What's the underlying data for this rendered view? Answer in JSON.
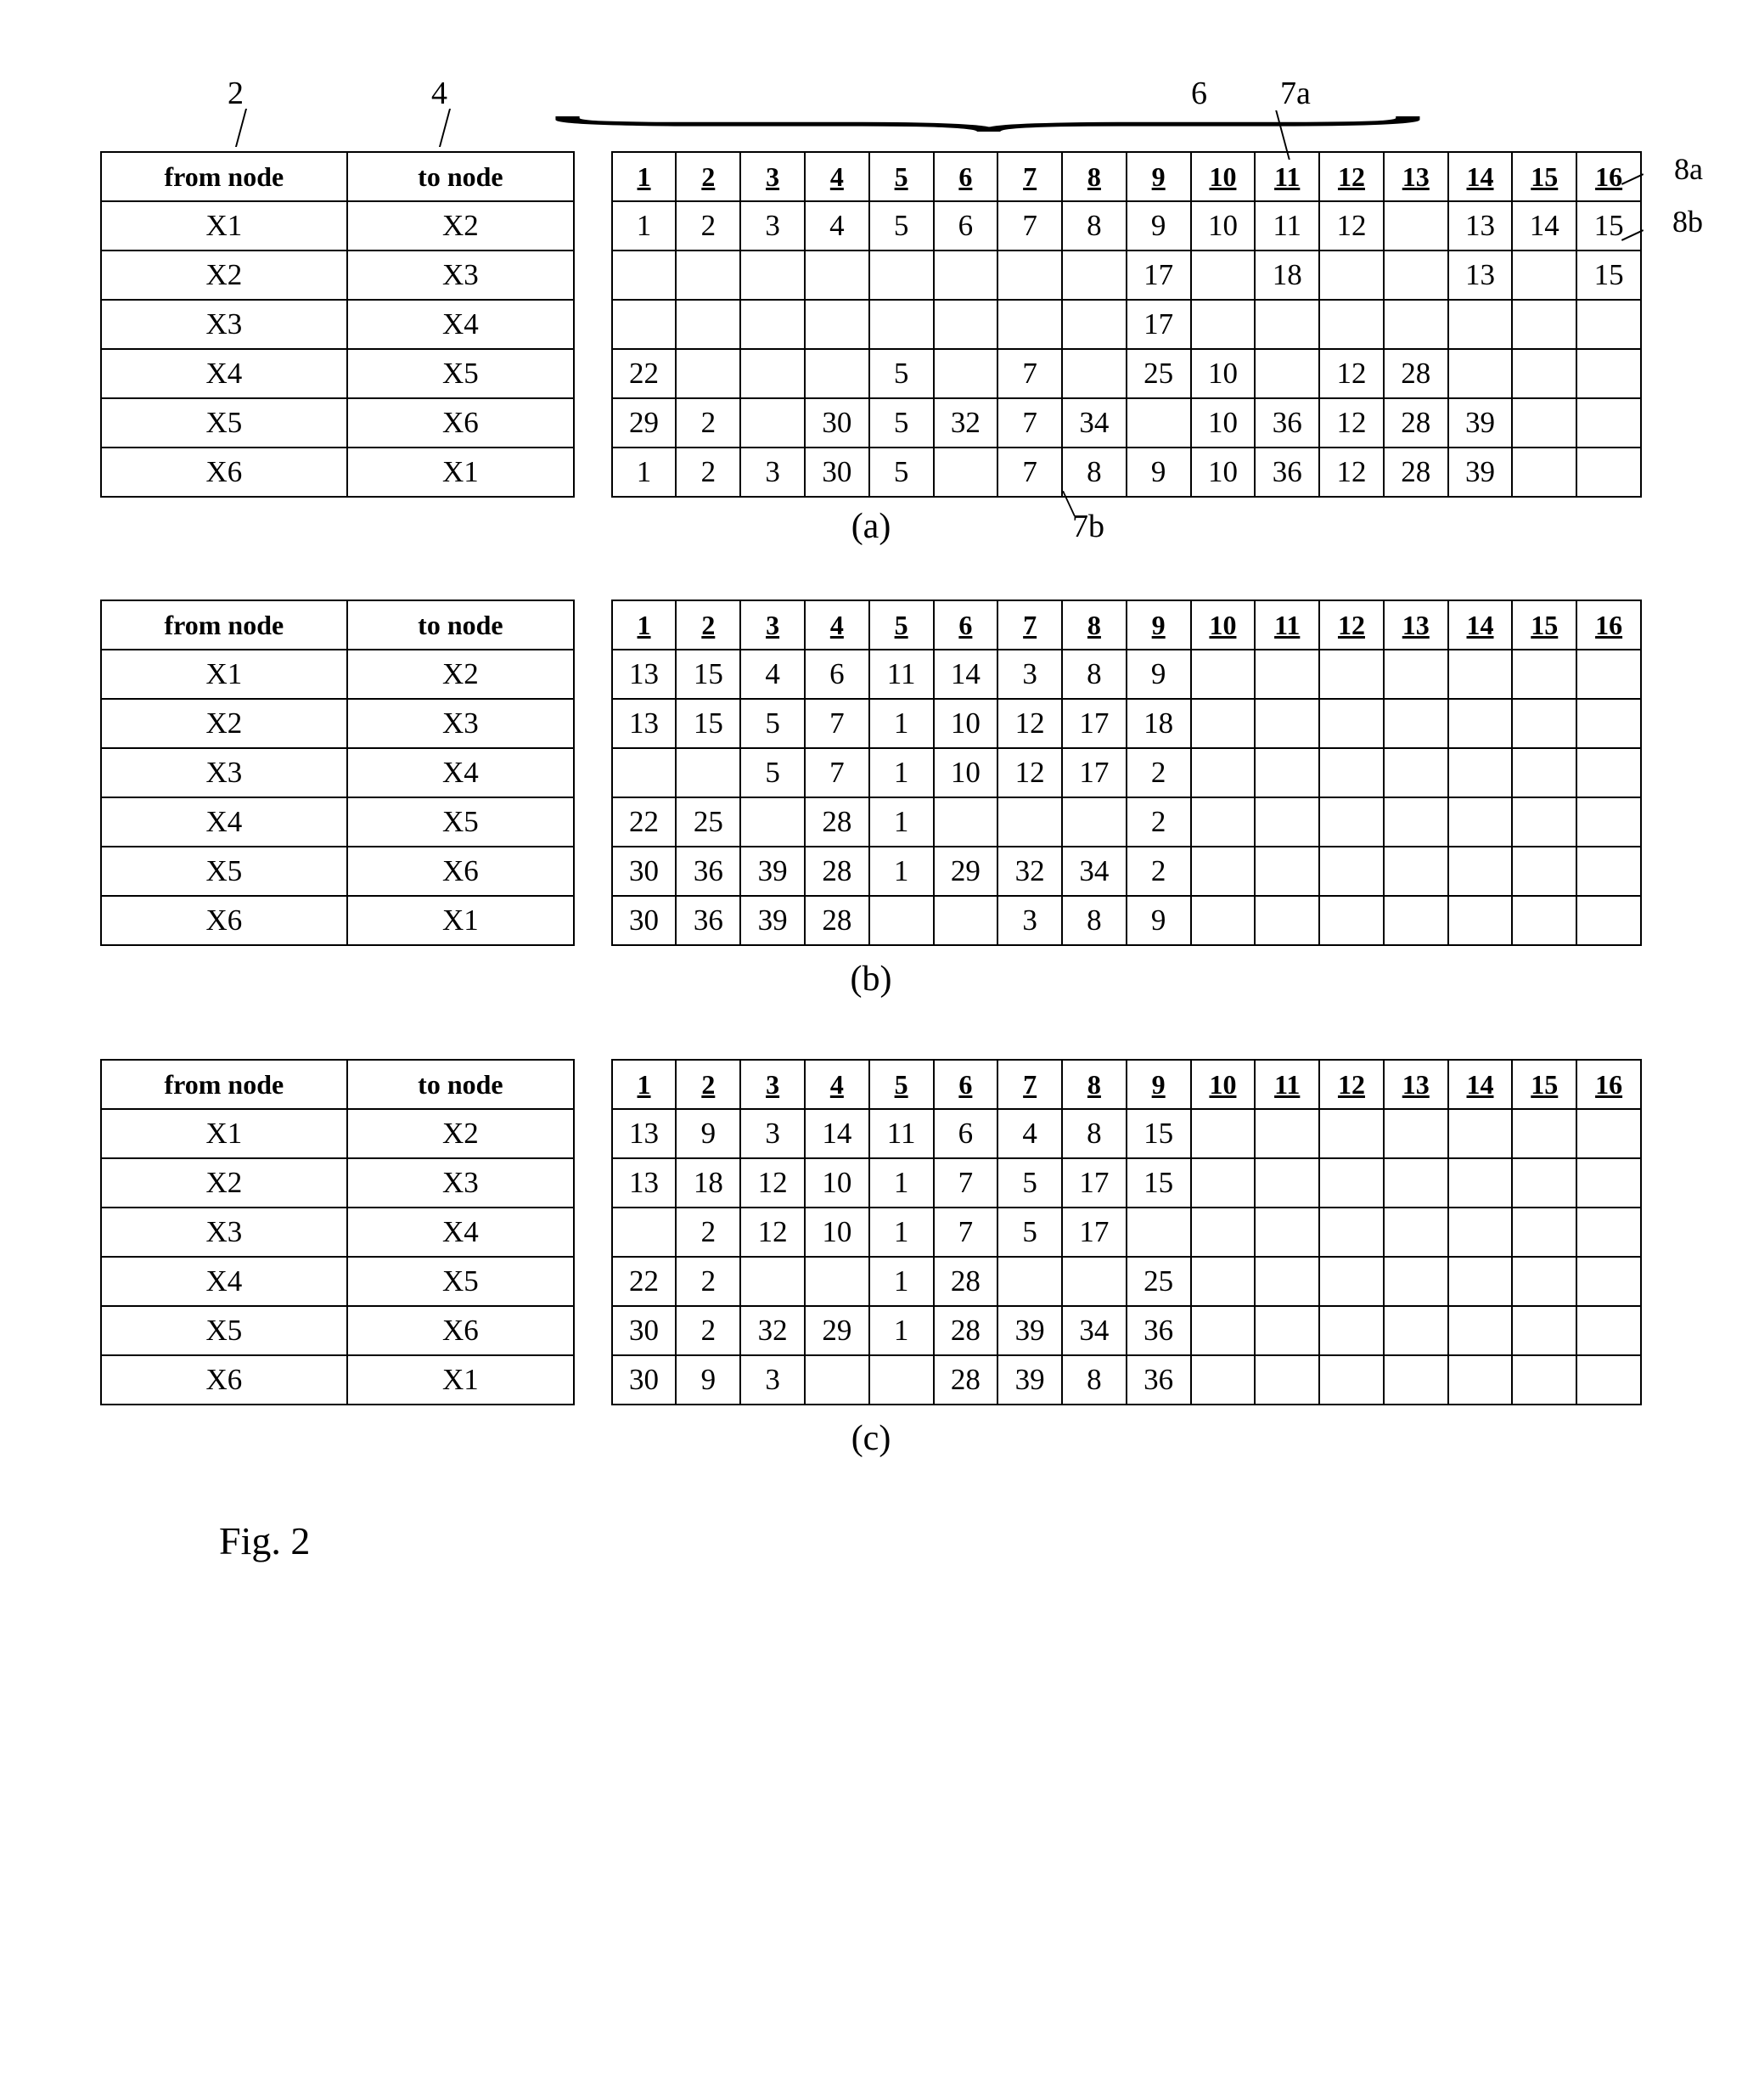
{
  "annotations": {
    "a2": "2",
    "a4": "4",
    "a6": "6",
    "a7a": "7a",
    "a7b": "7b",
    "a8a": "8a",
    "a8b": "8b"
  },
  "headers": {
    "from": "from node",
    "to": "to node",
    "cols": [
      "1",
      "2",
      "3",
      "4",
      "5",
      "6",
      "7",
      "8",
      "9",
      "10",
      "11",
      "12",
      "13",
      "14",
      "15",
      "16"
    ]
  },
  "captions": {
    "a": "(a)",
    "b": "(b)",
    "c": "(c)"
  },
  "figLabel": "Fig. 2",
  "tables": {
    "a": [
      {
        "from": "X1",
        "to": "X2",
        "cells": [
          "1",
          "2",
          "3",
          "4",
          "5",
          "6",
          "7",
          "8",
          "9",
          "10",
          "11",
          "12",
          "",
          "13",
          "14",
          "15"
        ]
      },
      {
        "from": "X2",
        "to": "X3",
        "cells": [
          "",
          "",
          "",
          "",
          "",
          "",
          "",
          "",
          "17",
          "",
          "18",
          "",
          "",
          "13",
          "",
          "15"
        ]
      },
      {
        "from": "X3",
        "to": "X4",
        "cells": [
          "",
          "",
          "",
          "",
          "",
          "",
          "",
          "",
          "17",
          "",
          "",
          "",
          "",
          "",
          "",
          ""
        ]
      },
      {
        "from": "X4",
        "to": "X5",
        "cells": [
          "22",
          "",
          "",
          "",
          "5",
          "",
          "7",
          "",
          "25",
          "10",
          "",
          "12",
          "28",
          "",
          "",
          ""
        ]
      },
      {
        "from": "X5",
        "to": "X6",
        "cells": [
          "29",
          "2",
          "",
          "30",
          "5",
          "32",
          "7",
          "34",
          "",
          "10",
          "36",
          "12",
          "28",
          "39",
          "",
          ""
        ]
      },
      {
        "from": "X6",
        "to": "X1",
        "cells": [
          "1",
          "2",
          "3",
          "30",
          "5",
          "",
          "7",
          "8",
          "9",
          "10",
          "36",
          "12",
          "28",
          "39",
          "",
          ""
        ]
      }
    ],
    "b": [
      {
        "from": "X1",
        "to": "X2",
        "cells": [
          "13",
          "15",
          "4",
          "6",
          "11",
          "14",
          "3",
          "8",
          "9",
          "",
          "",
          "",
          "",
          "",
          "",
          ""
        ]
      },
      {
        "from": "X2",
        "to": "X3",
        "cells": [
          "13",
          "15",
          "5",
          "7",
          "1",
          "10",
          "12",
          "17",
          "18",
          "",
          "",
          "",
          "",
          "",
          "",
          ""
        ]
      },
      {
        "from": "X3",
        "to": "X4",
        "cells": [
          "",
          "",
          "5",
          "7",
          "1",
          "10",
          "12",
          "17",
          "2",
          "",
          "",
          "",
          "",
          "",
          "",
          ""
        ]
      },
      {
        "from": "X4",
        "to": "X5",
        "cells": [
          "22",
          "25",
          "",
          "28",
          "1",
          "",
          "",
          "",
          "2",
          "",
          "",
          "",
          "",
          "",
          "",
          ""
        ]
      },
      {
        "from": "X5",
        "to": "X6",
        "cells": [
          "30",
          "36",
          "39",
          "28",
          "1",
          "29",
          "32",
          "34",
          "2",
          "",
          "",
          "",
          "",
          "",
          "",
          ""
        ]
      },
      {
        "from": "X6",
        "to": "X1",
        "cells": [
          "30",
          "36",
          "39",
          "28",
          "",
          "",
          "3",
          "8",
          "9",
          "",
          "",
          "",
          "",
          "",
          "",
          ""
        ]
      }
    ],
    "c": [
      {
        "from": "X1",
        "to": "X2",
        "cells": [
          "13",
          "9",
          "3",
          "14",
          "11",
          "6",
          "4",
          "8",
          "15",
          "",
          "",
          "",
          "",
          "",
          "",
          ""
        ]
      },
      {
        "from": "X2",
        "to": "X3",
        "cells": [
          "13",
          "18",
          "12",
          "10",
          "1",
          "7",
          "5",
          "17",
          "15",
          "",
          "",
          "",
          "",
          "",
          "",
          ""
        ]
      },
      {
        "from": "X3",
        "to": "X4",
        "cells": [
          "",
          "2",
          "12",
          "10",
          "1",
          "7",
          "5",
          "17",
          "",
          "",
          "",
          "",
          "",
          "",
          "",
          ""
        ]
      },
      {
        "from": "X4",
        "to": "X5",
        "cells": [
          "22",
          "2",
          "",
          "",
          "1",
          "28",
          "",
          "",
          "25",
          "",
          "",
          "",
          "",
          "",
          "",
          ""
        ]
      },
      {
        "from": "X5",
        "to": "X6",
        "cells": [
          "30",
          "2",
          "32",
          "29",
          "1",
          "28",
          "39",
          "34",
          "36",
          "",
          "",
          "",
          "",
          "",
          "",
          ""
        ]
      },
      {
        "from": "X6",
        "to": "X1",
        "cells": [
          "30",
          "9",
          "3",
          "",
          "",
          "28",
          "39",
          "8",
          "36",
          "",
          "",
          "",
          "",
          "",
          "",
          ""
        ]
      }
    ]
  }
}
